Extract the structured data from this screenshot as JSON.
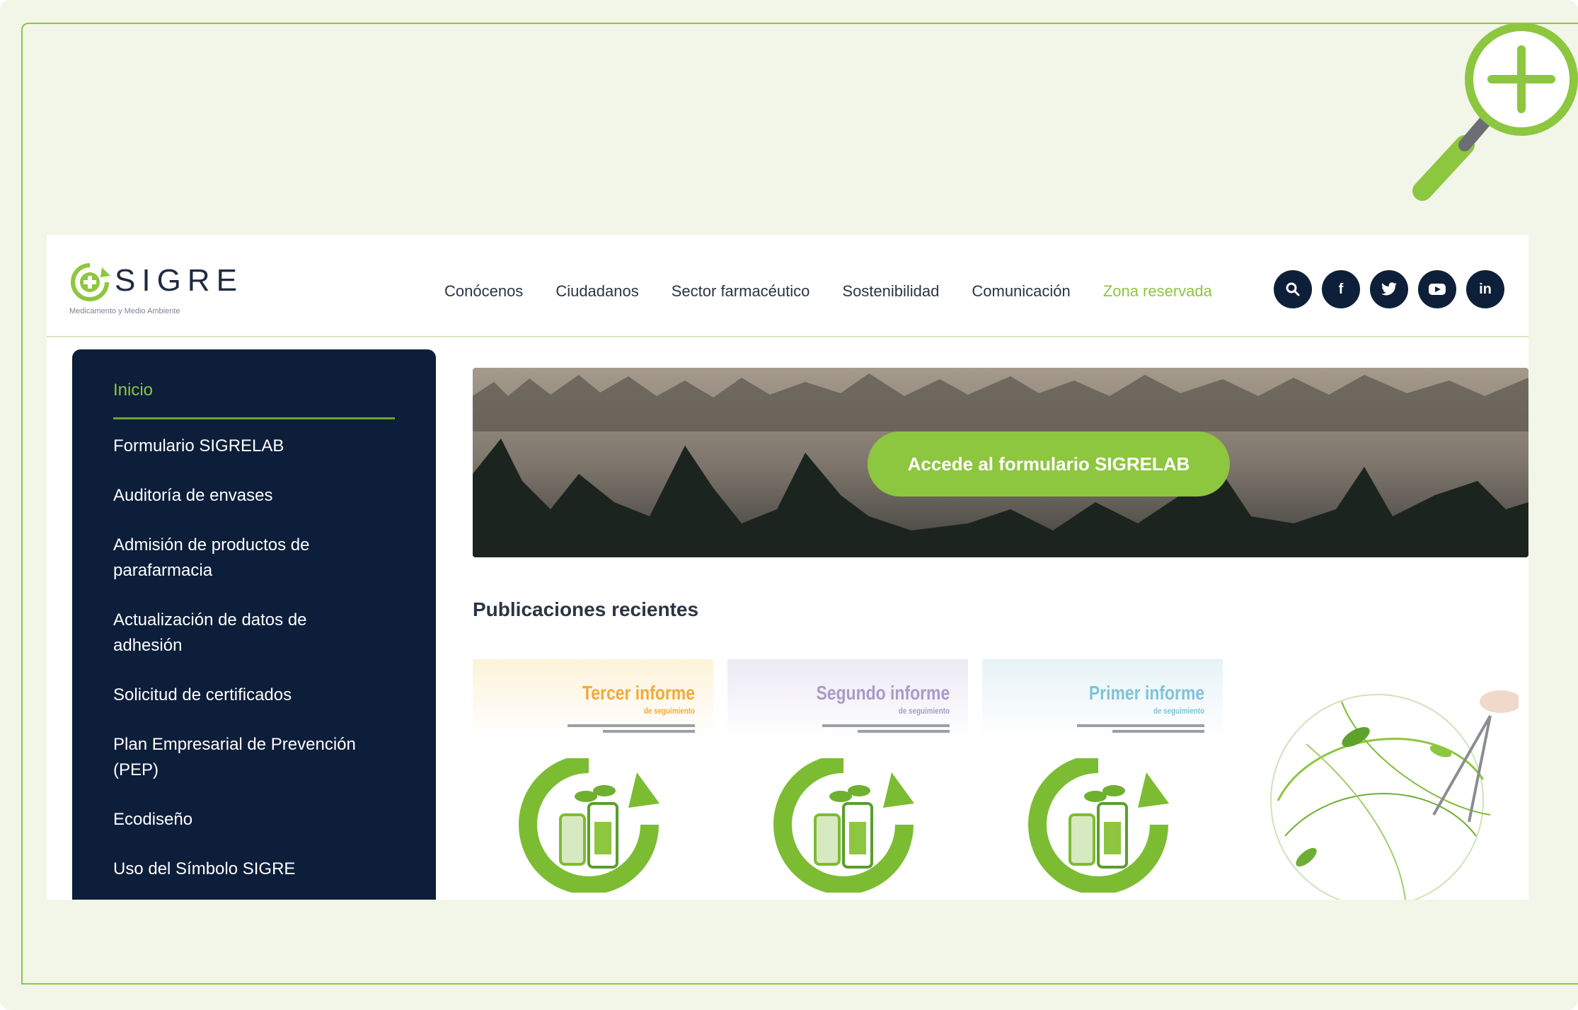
{
  "brand": {
    "name": "SIGRE",
    "tagline": "Medicamento y Medio Ambiente"
  },
  "nav": {
    "items": [
      "Conócenos",
      "Ciudadanos",
      "Sector farmacéutico",
      "Sostenibilidad",
      "Comunicación"
    ],
    "reserved": "Zona reservada"
  },
  "social": {
    "search_glyph": "🔍",
    "facebook": "f",
    "twitter": "t",
    "youtube": "▶",
    "linkedin": "in"
  },
  "sidebar": {
    "items": [
      "Inicio",
      "Formulario SIGRELAB",
      "Auditoría de envases",
      "Admisión de productos de parafarmacia",
      "Actualización de datos de adhesión",
      "Solicitud de certificados",
      "Plan Empresarial de Prevención (PEP)",
      "Ecodiseño",
      "Uso del Símbolo SIGRE"
    ]
  },
  "banner": {
    "cta": "Accede al formulario SIGRELAB"
  },
  "publications": {
    "title": "Publicaciones recientes",
    "cards": [
      {
        "title": "Tercer informe",
        "subtitle": "de seguimiento",
        "color": "#f2a93b"
      },
      {
        "title": "Segundo informe",
        "subtitle": "de seguimiento",
        "color": "#a79bc9"
      },
      {
        "title": "Primer informe",
        "subtitle": "de seguimiento",
        "color": "#7fc3d8"
      }
    ]
  },
  "colors": {
    "accent": "#8dc63f",
    "navy": "#0d1e3a"
  },
  "icons": {
    "zoom": "magnifier-plus-icon"
  }
}
